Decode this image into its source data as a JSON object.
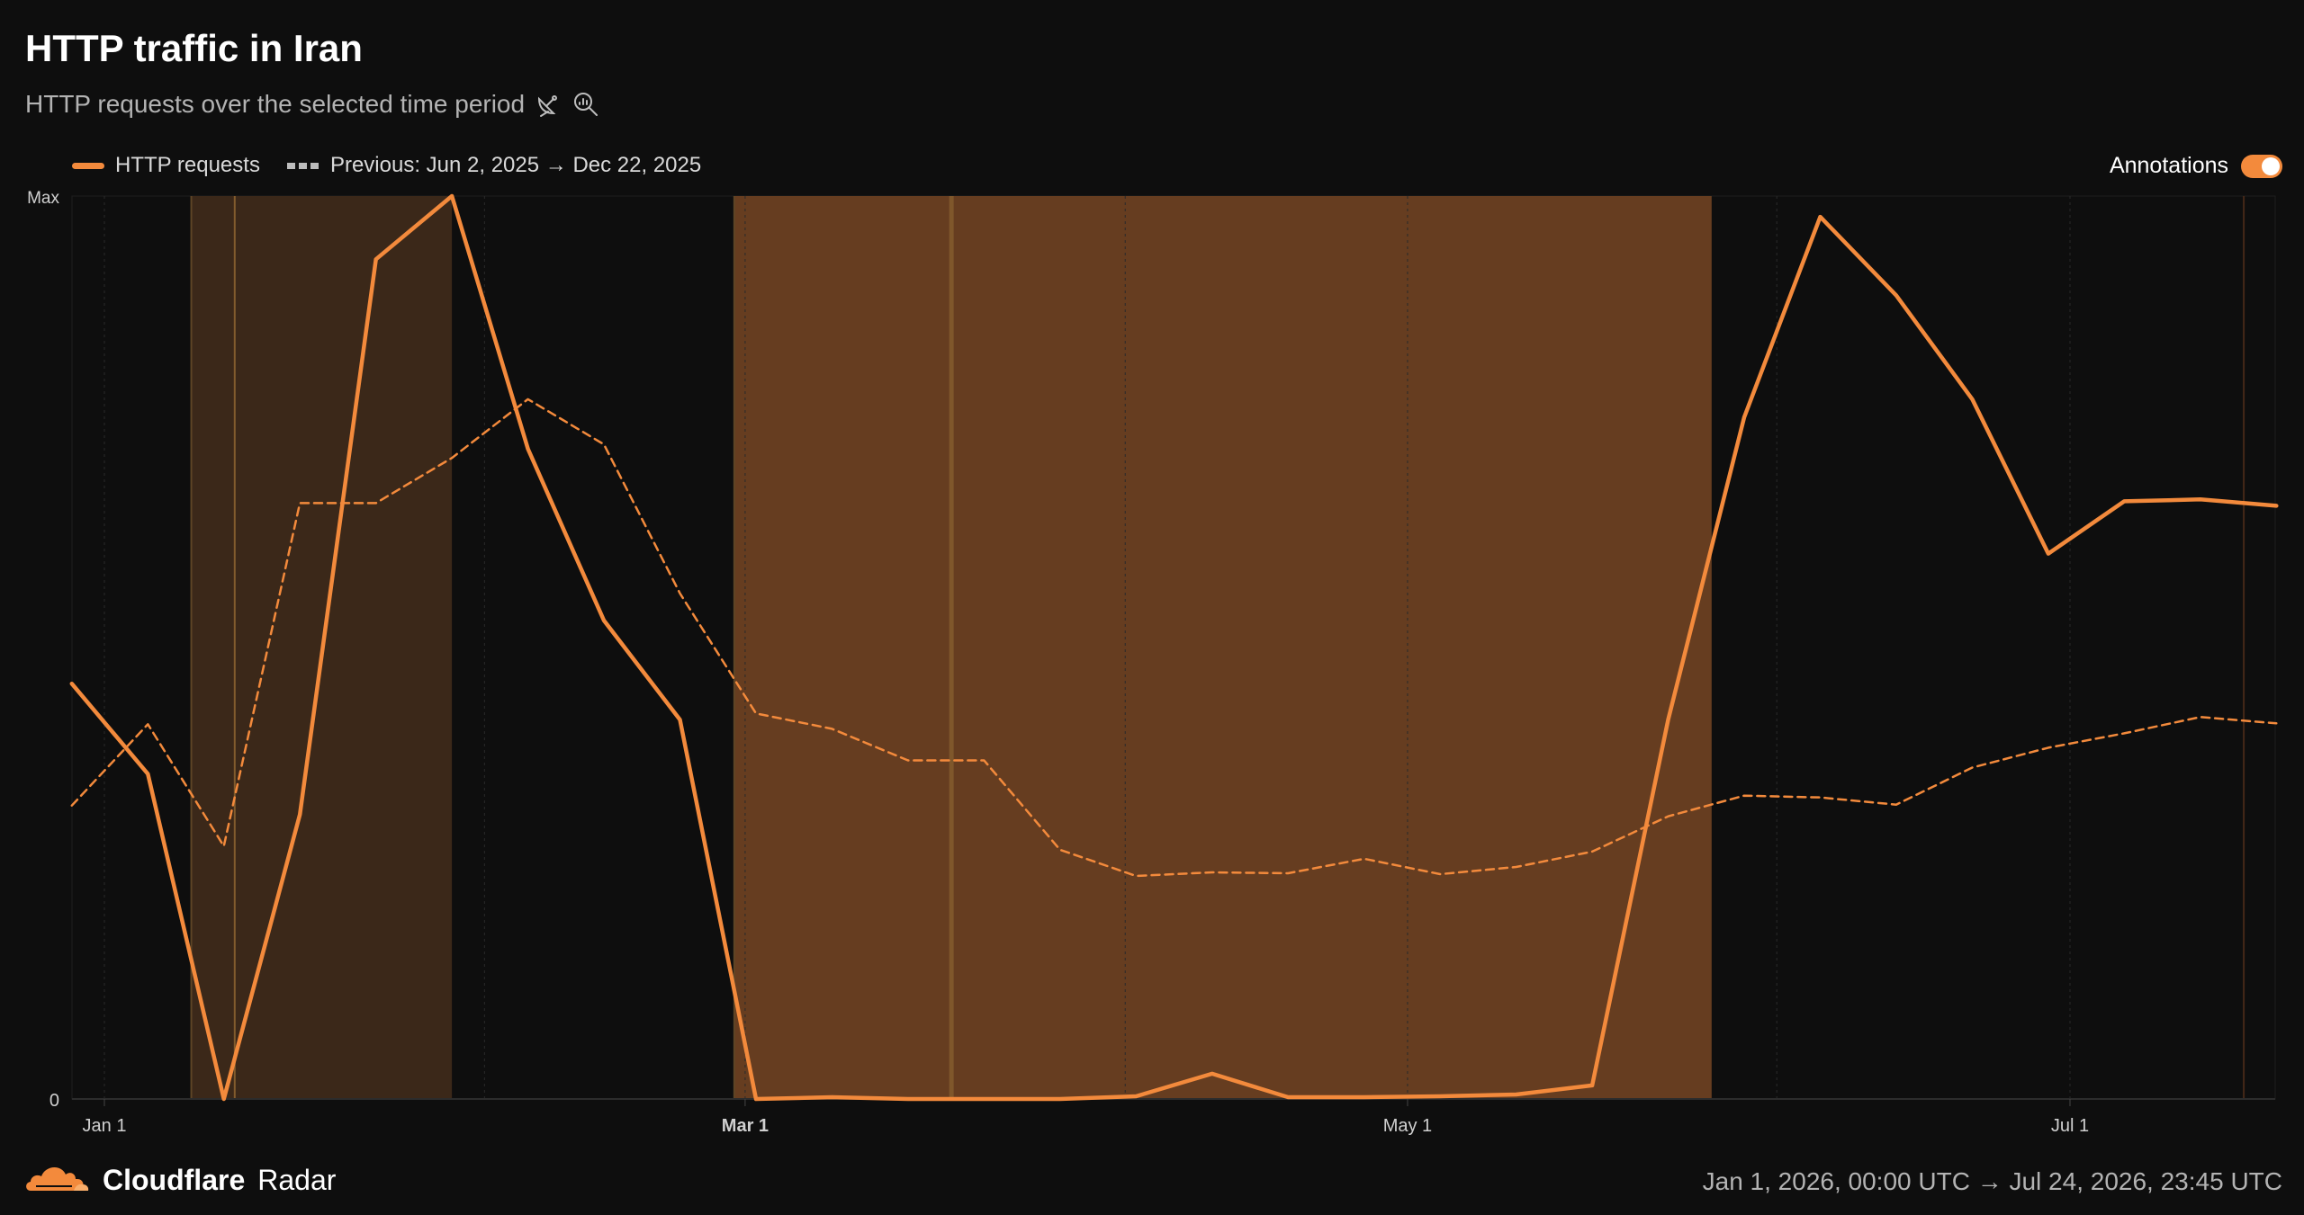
{
  "header": {
    "title": "HTTP traffic in Iran",
    "subtitle": "HTTP requests over the selected time period"
  },
  "legend": {
    "current": "HTTP requests",
    "previous": "Previous: Jun 2, 2025 → Dec 22, 2025"
  },
  "annotations_toggle": {
    "label": "Annotations",
    "on": true
  },
  "footer": {
    "brand": "Cloudflare",
    "product": "Radar",
    "range": "Jan 1, 2026, 00:00 UTC → Jul 24, 2026, 23:45 UTC"
  },
  "colors": {
    "accent": "#f38a3c",
    "background": "#0e0e0e"
  },
  "chart_data": {
    "type": "line",
    "title": "HTTP traffic in Iran",
    "x_range": [
      "2026-01-01",
      "2026-07-24"
    ],
    "y_range": [
      0,
      1
    ],
    "y_ticks": [
      "0",
      "Max"
    ],
    "x_ticks": [
      {
        "label": "Jan 1",
        "date": "2026-01-01",
        "bold": false
      },
      {
        "label": "Mar 1",
        "date": "2026-03-01",
        "bold": true
      },
      {
        "label": "May 1",
        "date": "2026-05-01",
        "bold": false
      },
      {
        "label": "Jul 1",
        "date": "2026-07-01",
        "bold": false
      }
    ],
    "grid": true,
    "legend_position": "top-left",
    "annotation_regions": [
      {
        "start": "2026-01-09",
        "end": "2026-02-02",
        "intensity": "light"
      },
      {
        "start": "2026-02-28",
        "end": "2026-05-29",
        "intensity": "strong"
      }
    ],
    "annotation_lines": [
      "2026-01-13",
      "2026-03-20",
      "2026-07-17"
    ],
    "series": [
      {
        "name": "HTTP requests",
        "style": "solid",
        "points": [
          [
            "2025-12-29",
            0.46
          ],
          [
            "2026-01-05",
            0.36
          ],
          [
            "2026-01-12",
            0.0
          ],
          [
            "2026-01-19",
            0.315
          ],
          [
            "2026-01-26",
            0.93
          ],
          [
            "2026-02-02",
            1.0
          ],
          [
            "2026-02-09",
            0.72
          ],
          [
            "2026-02-16",
            0.53
          ],
          [
            "2026-02-23",
            0.42
          ],
          [
            "2026-03-02",
            0.0
          ],
          [
            "2026-03-09",
            0.002
          ],
          [
            "2026-03-16",
            0.0
          ],
          [
            "2026-03-23",
            0.0
          ],
          [
            "2026-03-30",
            0.0
          ],
          [
            "2026-04-06",
            0.003
          ],
          [
            "2026-04-13",
            0.028
          ],
          [
            "2026-04-20",
            0.002
          ],
          [
            "2026-04-27",
            0.002
          ],
          [
            "2026-05-04",
            0.003
          ],
          [
            "2026-05-11",
            0.005
          ],
          [
            "2026-05-18",
            0.015
          ],
          [
            "2026-05-25",
            0.42
          ],
          [
            "2026-06-01",
            0.755
          ],
          [
            "2026-06-08",
            0.977
          ],
          [
            "2026-06-15",
            0.89
          ],
          [
            "2026-06-22",
            0.775
          ],
          [
            "2026-06-29",
            0.604
          ],
          [
            "2026-07-06",
            0.662
          ],
          [
            "2026-07-13",
            0.664
          ],
          [
            "2026-07-20",
            0.657
          ]
        ]
      },
      {
        "name": "Previous: Jun 2, 2025 → Dec 22, 2025",
        "style": "dashed",
        "points": [
          [
            "2025-12-29",
            0.325
          ],
          [
            "2026-01-05",
            0.415
          ],
          [
            "2026-01-12",
            0.28
          ],
          [
            "2026-01-19",
            0.66
          ],
          [
            "2026-01-26",
            0.66
          ],
          [
            "2026-02-02",
            0.71
          ],
          [
            "2026-02-09",
            0.775
          ],
          [
            "2026-02-16",
            0.725
          ],
          [
            "2026-02-23",
            0.56
          ],
          [
            "2026-03-02",
            0.427
          ],
          [
            "2026-03-09",
            0.41
          ],
          [
            "2026-03-16",
            0.375
          ],
          [
            "2026-03-23",
            0.375
          ],
          [
            "2026-03-30",
            0.276
          ],
          [
            "2026-04-06",
            0.247
          ],
          [
            "2026-04-13",
            0.251
          ],
          [
            "2026-04-20",
            0.25
          ],
          [
            "2026-04-27",
            0.266
          ],
          [
            "2026-05-04",
            0.249
          ],
          [
            "2026-05-11",
            0.257
          ],
          [
            "2026-05-18",
            0.274
          ],
          [
            "2026-05-25",
            0.313
          ],
          [
            "2026-06-01",
            0.336
          ],
          [
            "2026-06-08",
            0.334
          ],
          [
            "2026-06-15",
            0.326
          ],
          [
            "2026-06-22",
            0.367
          ],
          [
            "2026-06-29",
            0.389
          ],
          [
            "2026-07-06",
            0.405
          ],
          [
            "2026-07-13",
            0.423
          ],
          [
            "2026-07-20",
            0.416
          ]
        ]
      }
    ]
  }
}
